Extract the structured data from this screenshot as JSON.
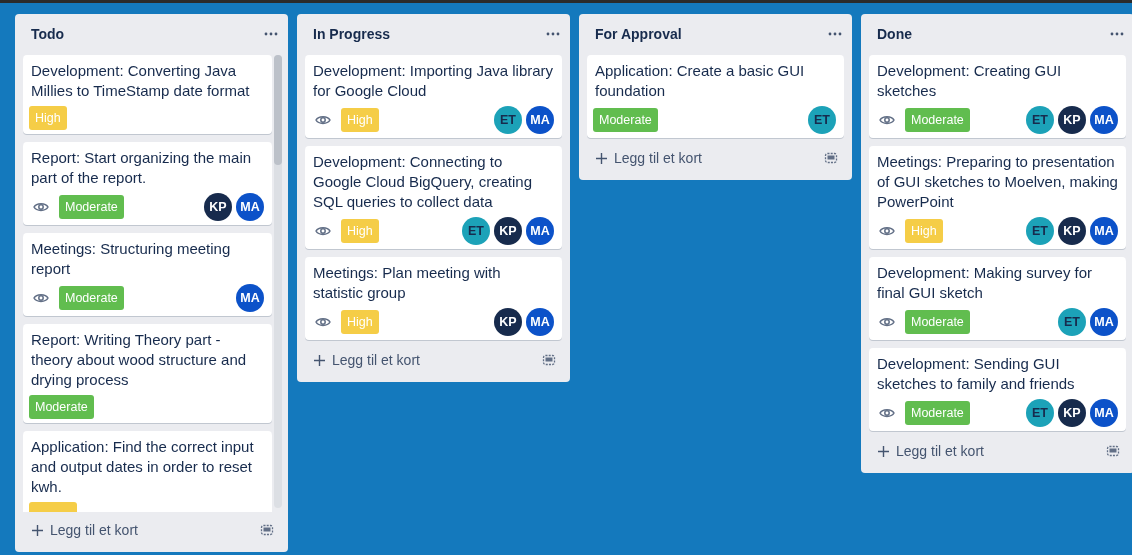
{
  "lists": [
    {
      "title": "Todo",
      "scrollable": true,
      "add_label": "Legg til et kort",
      "cards": [
        {
          "title": "Development: Converting Java Millies to TimeStamp date format",
          "watching": false,
          "labels": [
            {
              "text": "High",
              "color": "#f5cd47"
            }
          ]
        },
        {
          "title": "Report: Start organizing the main part of the report.",
          "watching": true,
          "labels": [
            {
              "text": "Moderate",
              "color": "#61bd4f"
            }
          ],
          "members": [
            {
              "initials": "KP",
              "color": "#172b4d"
            },
            {
              "initials": "MA",
              "color": "#0c52c9"
            }
          ]
        },
        {
          "title": "Meetings: Structuring meeting report",
          "watching": true,
          "labels": [
            {
              "text": "Moderate",
              "color": "#61bd4f"
            }
          ],
          "members": [
            {
              "initials": "MA",
              "color": "#0c52c9"
            }
          ]
        },
        {
          "title": "Report: Writing Theory part - theory about wood structure and drying process",
          "watching": false,
          "labels": [
            {
              "text": "Moderate",
              "color": "#61bd4f"
            }
          ]
        },
        {
          "title": "Application: Find the correct input and output dates in order to reset kwh.",
          "watching": false,
          "labels": [
            {
              "color": "#f5cd47"
            }
          ]
        }
      ]
    },
    {
      "title": "In Progress",
      "scrollable": false,
      "add_label": "Legg til et kort",
      "cards": [
        {
          "title": "Development: Importing Java library for Google Cloud",
          "watching": true,
          "labels": [
            {
              "text": "High",
              "color": "#f5cd47"
            }
          ],
          "members": [
            {
              "initials": "ET",
              "color": "#1ca2b8"
            },
            {
              "initials": "MA",
              "color": "#0c52c9"
            }
          ]
        },
        {
          "title": "Development: Connecting to Google Cloud BigQuery, creating SQL queries to collect data",
          "watching": true,
          "labels": [
            {
              "text": "High",
              "color": "#f5cd47"
            }
          ],
          "members": [
            {
              "initials": "ET",
              "color": "#1ca2b8"
            },
            {
              "initials": "KP",
              "color": "#172b4d"
            },
            {
              "initials": "MA",
              "color": "#0c52c9"
            }
          ]
        },
        {
          "title": "Meetings: Plan meeting with statistic group",
          "watching": true,
          "labels": [
            {
              "text": "High",
              "color": "#f5cd47"
            }
          ],
          "members": [
            {
              "initials": "KP",
              "color": "#172b4d"
            },
            {
              "initials": "MA",
              "color": "#0c52c9"
            }
          ]
        }
      ]
    },
    {
      "title": "For Approval",
      "scrollable": false,
      "add_label": "Legg til et kort",
      "cards": [
        {
          "title": "Application: Create a basic GUI foundation",
          "watching": false,
          "labels": [
            {
              "text": "Moderate",
              "color": "#61bd4f"
            }
          ],
          "members": [
            {
              "initials": "ET",
              "color": "#1ca2b8"
            }
          ]
        }
      ]
    },
    {
      "title": "Done",
      "scrollable": false,
      "add_label": "Legg til et kort",
      "cards": [
        {
          "title": "Development: Creating GUI sketches",
          "watching": true,
          "labels": [
            {
              "text": "Moderate",
              "color": "#61bd4f"
            }
          ],
          "members": [
            {
              "initials": "ET",
              "color": "#1ca2b8"
            },
            {
              "initials": "KP",
              "color": "#172b4d"
            },
            {
              "initials": "MA",
              "color": "#0c52c9"
            }
          ]
        },
        {
          "title": "Meetings: Preparing to presentation of GUI sketches to Moelven, making PowerPoint",
          "watching": true,
          "labels": [
            {
              "text": "High",
              "color": "#f5cd47"
            }
          ],
          "members": [
            {
              "initials": "ET",
              "color": "#1ca2b8"
            },
            {
              "initials": "KP",
              "color": "#172b4d"
            },
            {
              "initials": "MA",
              "color": "#0c52c9"
            }
          ]
        },
        {
          "title": "Development: Making survey for final GUI sketch",
          "watching": true,
          "labels": [
            {
              "text": "Moderate",
              "color": "#61bd4f"
            }
          ],
          "members": [
            {
              "initials": "ET",
              "color": "#1ca2b8"
            },
            {
              "initials": "MA",
              "color": "#0c52c9"
            }
          ]
        },
        {
          "title": "Development: Sending GUI sketches to family and friends",
          "watching": true,
          "labels": [
            {
              "text": "Moderate",
              "color": "#61bd4f"
            }
          ],
          "members": [
            {
              "initials": "ET",
              "color": "#1ca2b8"
            },
            {
              "initials": "KP",
              "color": "#172b4d"
            },
            {
              "initials": "MA",
              "color": "#0c52c9"
            }
          ]
        }
      ]
    }
  ]
}
